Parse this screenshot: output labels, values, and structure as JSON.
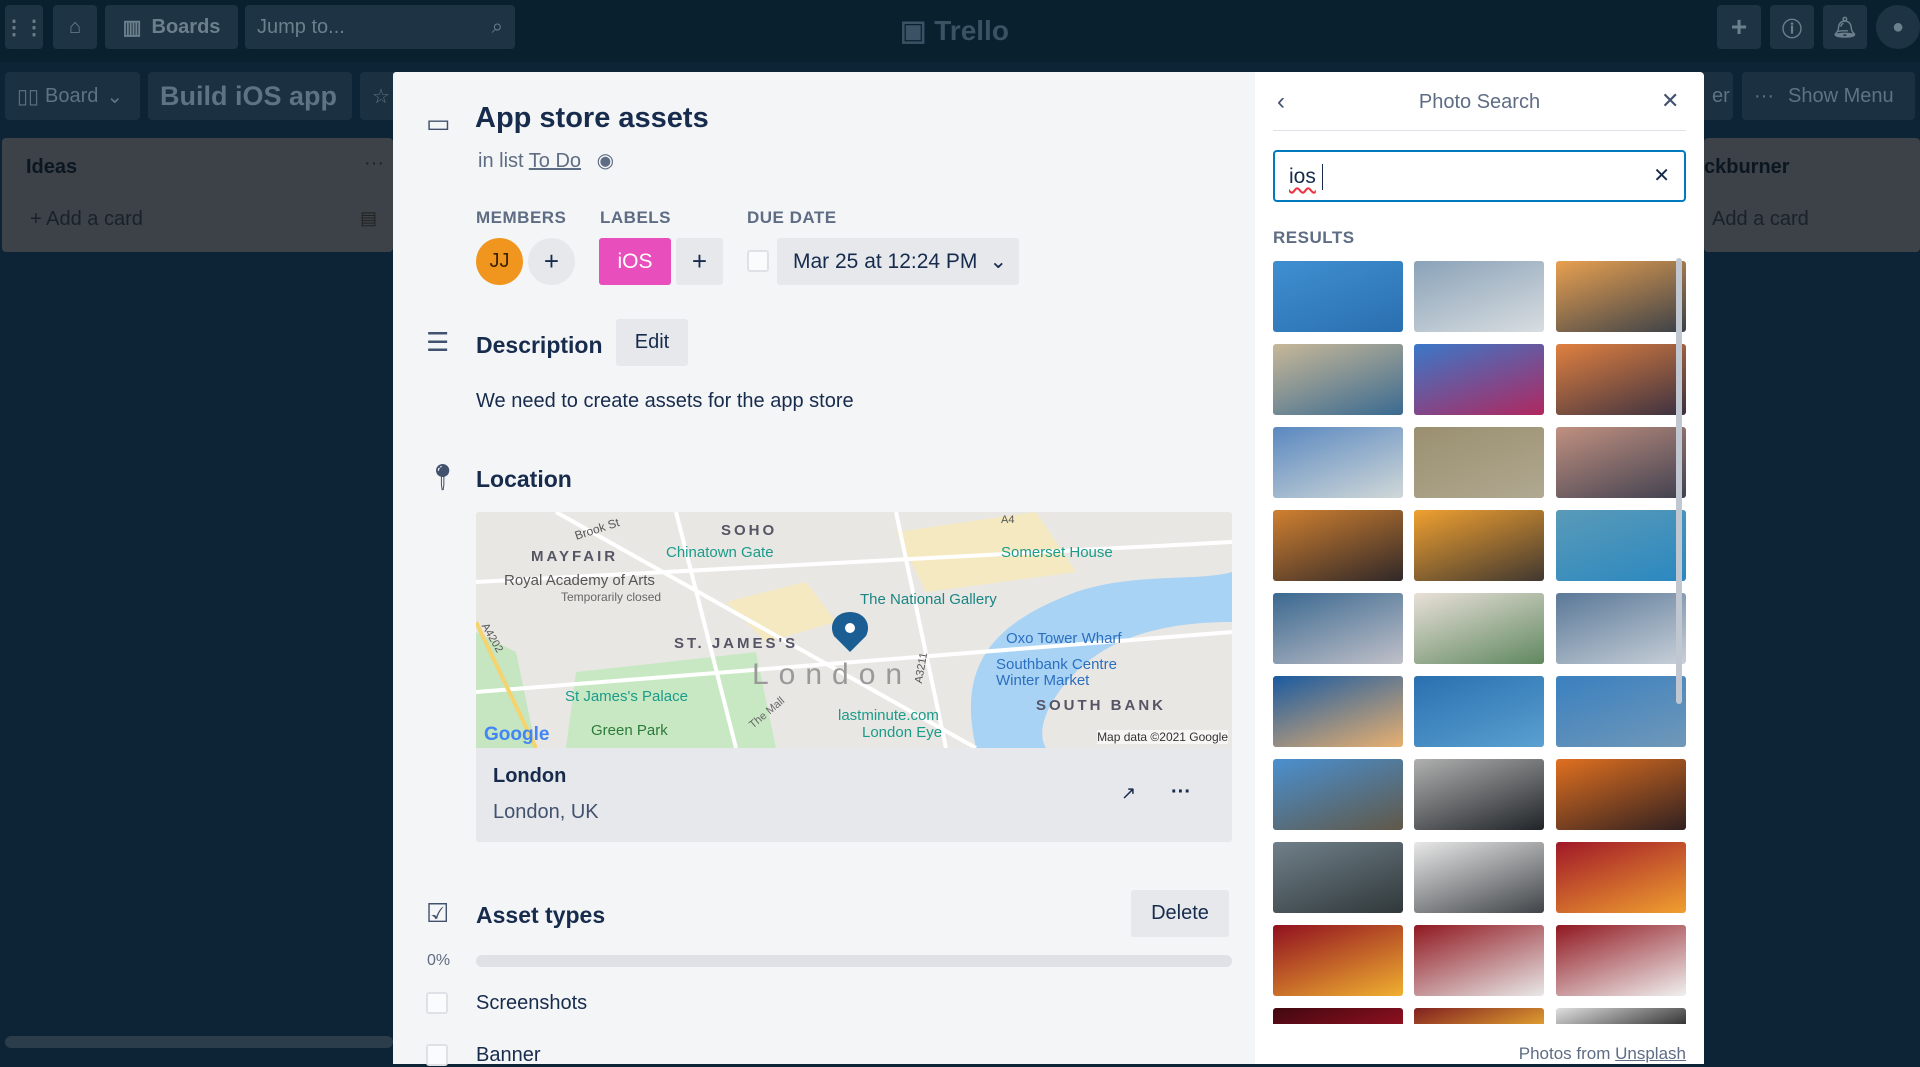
{
  "header": {
    "boards_label": "Boards",
    "search_placeholder": "Jump to...",
    "logo": "Trello"
  },
  "boardbar": {
    "view": "Board",
    "board_name": "Build iOS app",
    "show_menu": "Show Menu",
    "filter_partial": "er"
  },
  "lists": [
    {
      "title": "Ideas",
      "add": "Add a card"
    },
    {
      "title": "ckburner",
      "add": "Add a card"
    }
  ],
  "card": {
    "title": "App store assets",
    "in_list_prefix": "in list",
    "list_name": "To Do",
    "members_label": "MEMBERS",
    "member_initials": "JJ",
    "labels_label": "LABELS",
    "label": "iOS",
    "label_color": "#e84fbd",
    "due_label": "DUE DATE",
    "due": "Mar 25 at 12:24 PM",
    "description_title": "Description",
    "edit": "Edit",
    "description": "We need to create assets for the app store",
    "location_title": "Location",
    "location_name": "London",
    "location_address": "London, UK",
    "map_labels": [
      "Brook St",
      "SOHO",
      "MAYFAIR",
      "Chinatown Gate",
      "Royal Academy of Arts",
      "Temporarily closed",
      "Somerset House",
      "The National Gallery",
      "ST. JAMES'S",
      "London",
      "Oxo Tower Wharf",
      "Southbank Centre",
      "Winter Market",
      "St James's Palace",
      "SOUTH BANK",
      "Green Park",
      "The Mall",
      "lastminute.com",
      "London Eye",
      "A4202",
      "A3211",
      "A4"
    ],
    "map_credit": "Map data ©2021 Google",
    "map_logo": "Google",
    "checklist_title": "Asset types",
    "delete": "Delete",
    "progress": "0%",
    "progress_value": 0,
    "items": [
      {
        "label": "Screenshots",
        "checked": false
      },
      {
        "label": "Banner",
        "checked": false
      }
    ]
  },
  "photo_search": {
    "title": "Photo Search",
    "query": "ios",
    "results_label": "RESULTS",
    "footer_prefix": "Photos from",
    "footer_link": "Unsplash",
    "photos": [
      [
        "#3f8fd0",
        "#2a6fb0"
      ],
      [
        "#8aa2b8",
        "#d8dde0"
      ],
      [
        "#e8a050",
        "#3a4048"
      ],
      [
        "#c8b898",
        "#3a6a90"
      ],
      [
        "#3a78c8",
        "#b02860"
      ],
      [
        "#e08040",
        "#3a3040"
      ],
      [
        "#5a88c0",
        "#d0d8d8"
      ],
      [
        "#9a9070",
        "#b0a890"
      ],
      [
        "#c09080",
        "#404050"
      ],
      [
        "#d08030",
        "#302828"
      ],
      [
        "#f0a030",
        "#403830"
      ],
      [
        "#5a9ab8",
        "#2a88c0"
      ],
      [
        "#3a6890",
        "#c0c0c8"
      ],
      [
        "#e8e0d8",
        "#608860"
      ],
      [
        "#5a7898",
        "#c8d0d8"
      ],
      [
        "#1a5aa0",
        "#e8b070"
      ],
      [
        "#2a70b0",
        "#5aa0d0"
      ],
      [
        "#3a80c0",
        "#7098b8"
      ],
      [
        "#4a90d0",
        "#605848"
      ],
      [
        "#b0b0b0",
        "#202428"
      ],
      [
        "#e07020",
        "#302020"
      ],
      [
        "#70808a",
        "#30383a"
      ],
      [
        "#e8e8e8",
        "#404448"
      ],
      [
        "#a01828",
        "#f0a030"
      ],
      [
        "#901020",
        "#f0b030"
      ],
      [
        "#901820",
        "#e8e8e8"
      ],
      [
        "#901820",
        "#f0f0f0"
      ],
      [
        "#400810",
        "#901020"
      ],
      [
        "#802020",
        "#e0a030"
      ],
      [
        "#e0e0e0",
        "#303030"
      ]
    ]
  }
}
